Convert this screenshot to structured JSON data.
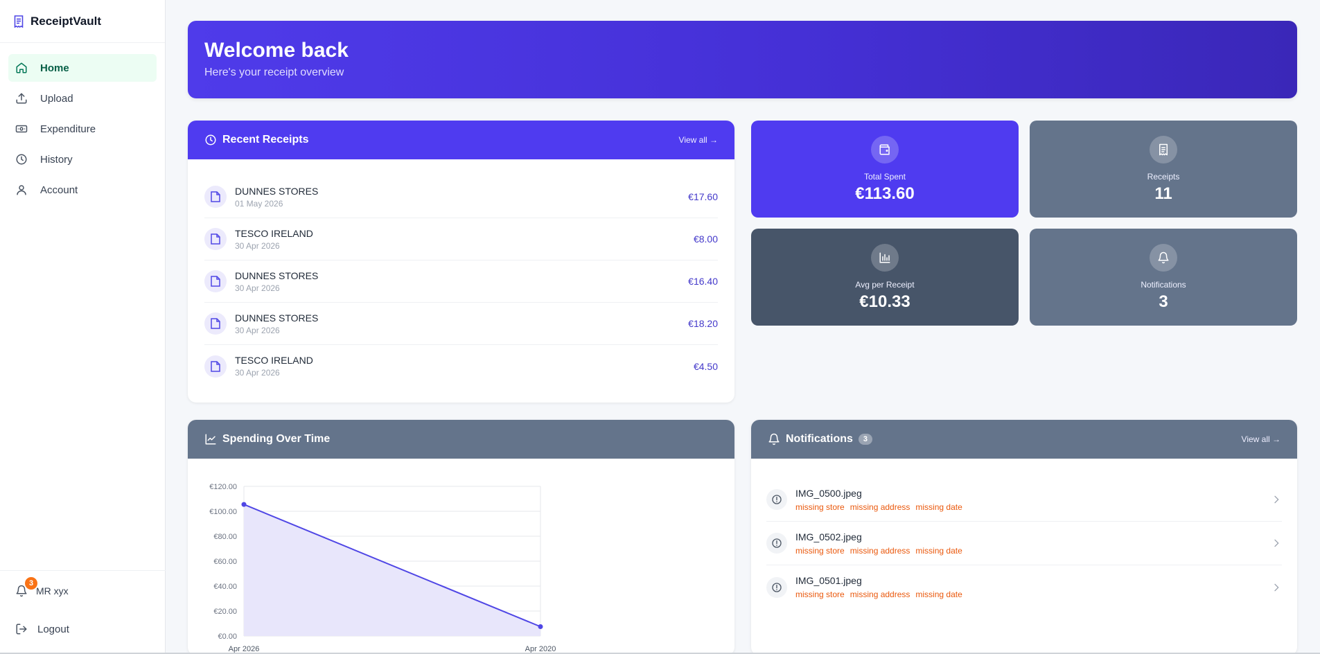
{
  "brand": {
    "name": "ReceiptVault",
    "icon": "receipt-icon"
  },
  "nav": {
    "items": [
      {
        "label": "Home",
        "icon": "home-icon",
        "active": true
      },
      {
        "label": "Upload",
        "icon": "upload-icon",
        "active": false
      },
      {
        "label": "Expenditure",
        "icon": "banknote-icon",
        "active": false
      },
      {
        "label": "History",
        "icon": "clock-icon",
        "active": false
      },
      {
        "label": "Account",
        "icon": "user-icon",
        "active": false
      }
    ]
  },
  "user": {
    "name": "MR xyx",
    "notification_count": "3"
  },
  "logout_label": "Logout",
  "hero": {
    "title": "Welcome back",
    "subtitle": "Here's your receipt overview"
  },
  "recent": {
    "title": "Recent Receipts",
    "view_all": "View all →",
    "rows": [
      {
        "store": "DUNNES STORES",
        "date": "01 May 2026",
        "amount": "€17.60"
      },
      {
        "store": "TESCO IRELAND",
        "date": "30 Apr 2026",
        "amount": "€8.00"
      },
      {
        "store": "DUNNES STORES",
        "date": "30 Apr 2026",
        "amount": "€16.40"
      },
      {
        "store": "DUNNES STORES",
        "date": "30 Apr 2026",
        "amount": "€18.20"
      },
      {
        "store": "TESCO IRELAND",
        "date": "30 Apr 2026",
        "amount": "€4.50"
      }
    ]
  },
  "stats": {
    "total": {
      "label": "Total Spent",
      "value": "€113.60",
      "icon": "wallet-icon"
    },
    "receipts": {
      "label": "Receipts",
      "value": "11",
      "icon": "receipt-icon"
    },
    "avg": {
      "label": "Avg per Receipt",
      "value": "€10.33",
      "icon": "bar-chart-icon"
    },
    "notifications": {
      "label": "Notifications",
      "value": "3",
      "icon": "bell-icon"
    }
  },
  "spending": {
    "title": "Spending Over Time"
  },
  "chart_data": {
    "type": "area",
    "categories": [
      "Apr 2026",
      "Apr 2020"
    ],
    "values": [
      105.5,
      7.5
    ],
    "yticks": [
      "€0.00",
      "€20.00",
      "€40.00",
      "€60.00",
      "€80.00",
      "€100.00",
      "€120.00"
    ],
    "ylim": [
      0,
      120
    ],
    "grid": true,
    "colors": {
      "line": "#4f46e5",
      "fill": "#e8e6fb"
    }
  },
  "notifications": {
    "title": "Notifications",
    "count": "3",
    "view_all": "View all →",
    "rows": [
      {
        "file": "IMG_0500.jpeg",
        "tags": [
          "missing store",
          "missing address",
          "missing date"
        ]
      },
      {
        "file": "IMG_0502.jpeg",
        "tags": [
          "missing store",
          "missing address",
          "missing date"
        ]
      },
      {
        "file": "IMG_0501.jpeg",
        "tags": [
          "missing store",
          "missing address",
          "missing date"
        ]
      }
    ]
  }
}
